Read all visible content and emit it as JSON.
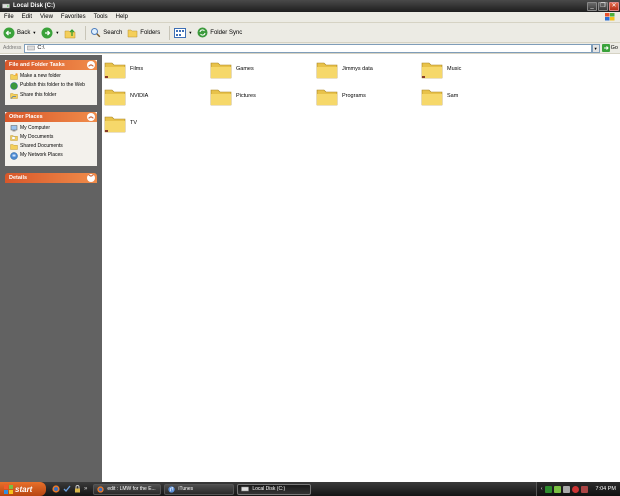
{
  "window": {
    "title": "Local Disk (C:)"
  },
  "menu": [
    "File",
    "Edit",
    "View",
    "Favorites",
    "Tools",
    "Help"
  ],
  "toolbar": {
    "back": "Back",
    "search": "Search",
    "folders": "Folders",
    "folder_sync": "Folder Sync"
  },
  "address": {
    "label": "Address",
    "value": "C:\\",
    "go": "Go"
  },
  "panes": {
    "file_tasks": {
      "title": "File and Folder Tasks",
      "items": [
        "Make a new folder",
        "Publish this folder to the Web",
        "Share this folder"
      ]
    },
    "other_places": {
      "title": "Other Places",
      "items": [
        "My Computer",
        "My Documents",
        "Shared Documents",
        "My Network Places"
      ]
    },
    "details": {
      "title": "Details"
    }
  },
  "folders": [
    "Films",
    "Games",
    "Jimmys data",
    "Music",
    "NVIDIA",
    "Pictures",
    "Programs",
    "Sam",
    "TV"
  ],
  "taskbar": {
    "start": "start",
    "tasks": [
      "edit : LMW for the E...",
      "iTunes",
      "Local Disk (C:)"
    ],
    "clock": "7:04 PM"
  },
  "colors": {
    "pane_head": "#e06a34",
    "taskbar": "#1e1e1e",
    "left_pane": "#626262"
  }
}
